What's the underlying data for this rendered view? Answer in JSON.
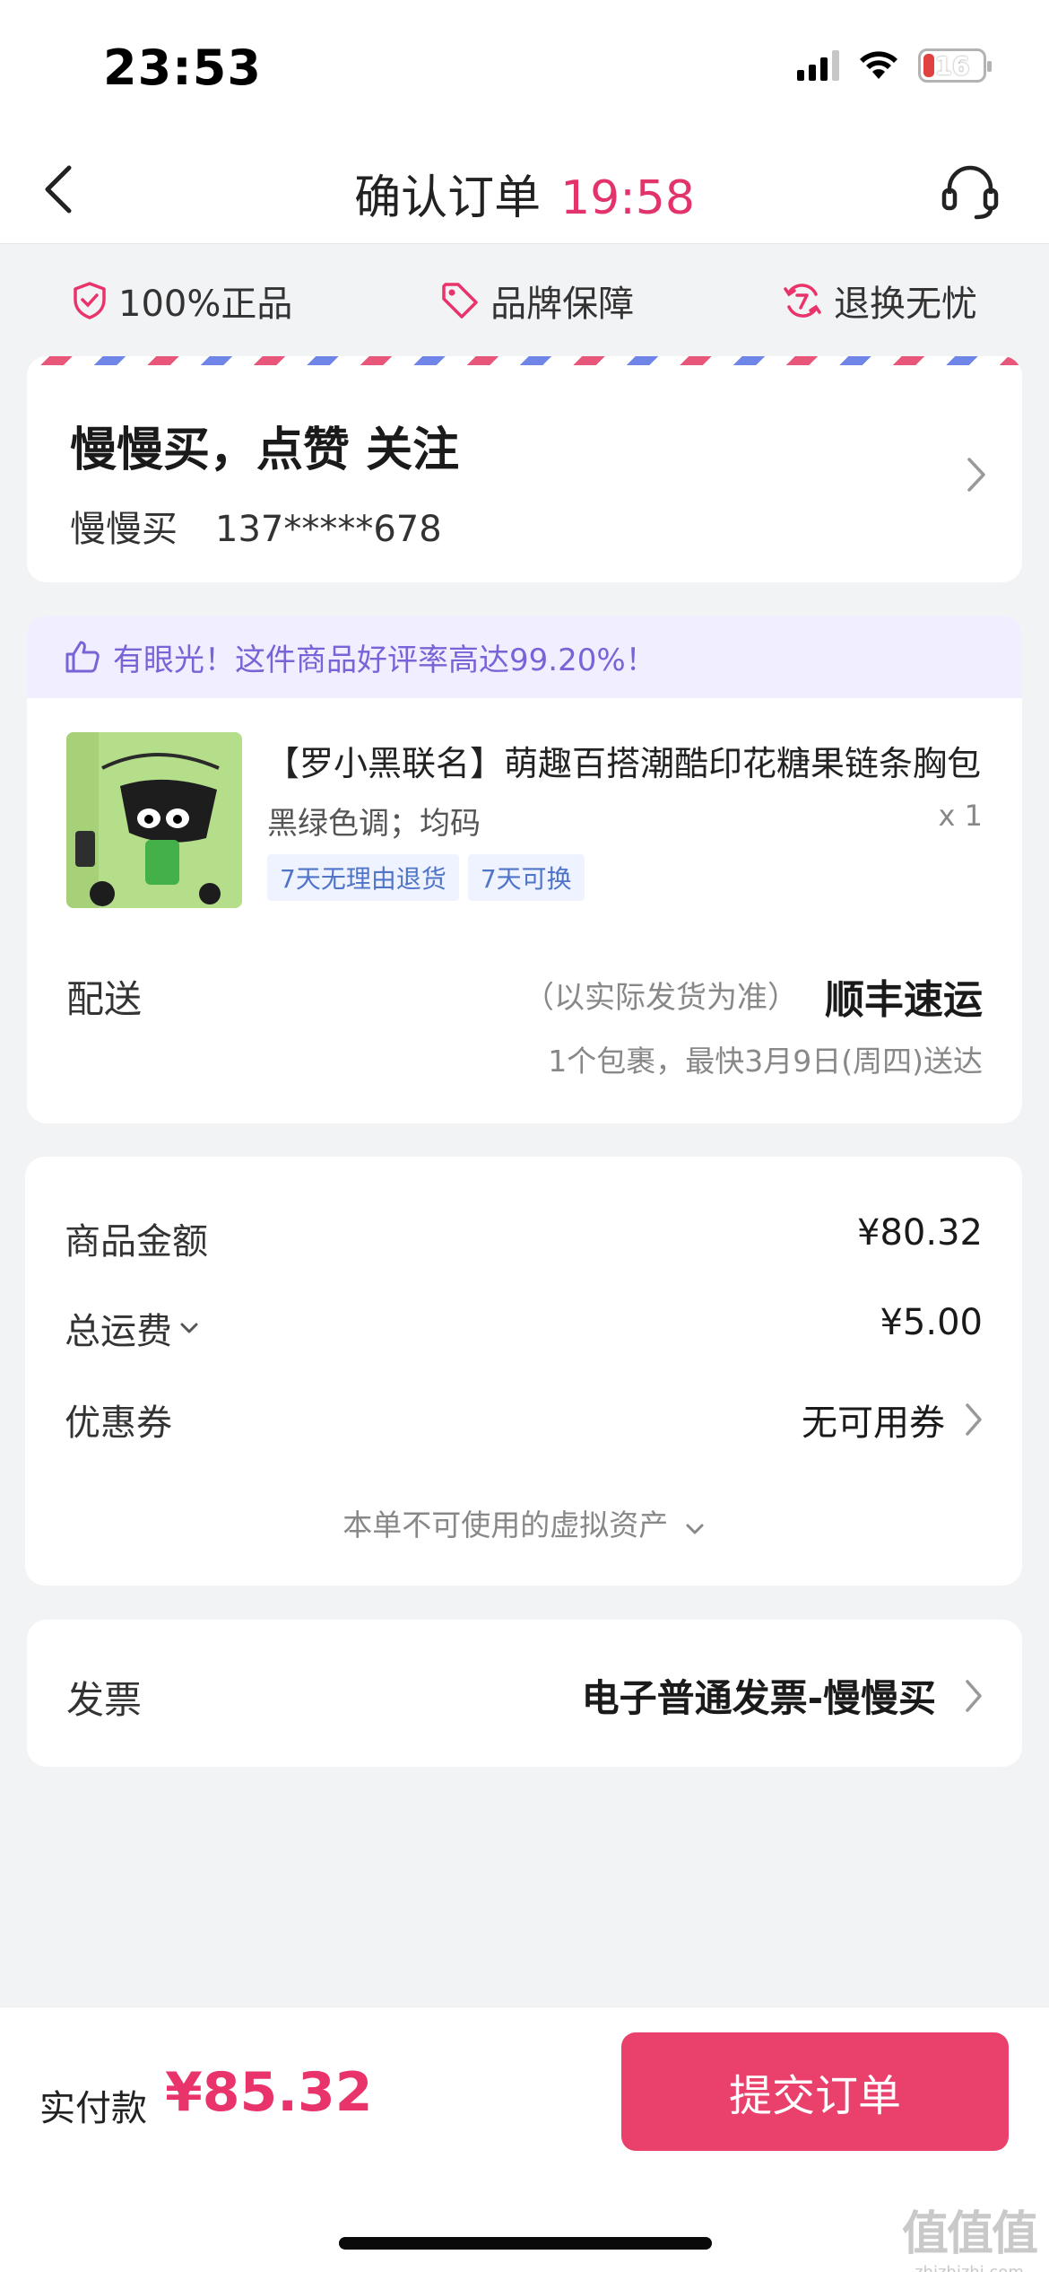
{
  "status_bar": {
    "time": "23:53",
    "battery": "16"
  },
  "nav": {
    "title": "确认订单",
    "timer": "19:58"
  },
  "guarantees": [
    {
      "label": "100%正品",
      "icon": "shield-check-icon"
    },
    {
      "label": "品牌保障",
      "icon": "price-tag-icon"
    },
    {
      "label": "退换无忧",
      "icon": "refresh-7-icon"
    }
  ],
  "address": {
    "name": "慢慢买，点赞 关注",
    "recipient": "慢慢买",
    "phone": "137*****678"
  },
  "product": {
    "praise": "有眼光！这件商品好评率高达99.20%！",
    "title": "【罗小黑联名】萌趣百搭潮酷印花糖果链条胸包",
    "spec": "黑绿色调；均码",
    "quantity": "x 1",
    "tags": [
      "7天无理由退货",
      "7天可换"
    ]
  },
  "shipping": {
    "label": "配送",
    "note": "（以实际发货为准）",
    "method": "顺丰速运",
    "eta": "1个包裹，最快3月9日(周四)送达"
  },
  "price": {
    "goods_label": "商品金额",
    "goods_value": "¥80.32",
    "freight_label": "总运费",
    "freight_value": "¥5.00",
    "coupon_label": "优惠券",
    "coupon_value": "无可用券",
    "virtual_assets": "本单不可使用的虚拟资产"
  },
  "invoice": {
    "label": "发票",
    "value": "电子普通发票-慢慢买"
  },
  "footer": {
    "pay_label": "实付款",
    "pay_amount": "¥85.32",
    "submit": "提交订单"
  },
  "watermark": {
    "logo": "值值值",
    "url": "zhizhizhi.com"
  },
  "colors": {
    "accent": "#e9406c",
    "timer": "#e2336b",
    "praise_bg": "#f1efff",
    "praise_text": "#7a63d6",
    "tag_text": "#4f74c8"
  }
}
